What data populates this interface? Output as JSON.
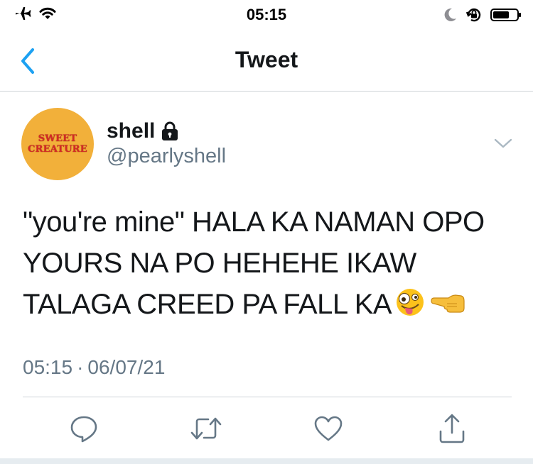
{
  "status_bar": {
    "time": "05:15",
    "battery_level": 0.7,
    "icons": [
      "airplane-icon",
      "wifi-icon",
      "moon-icon",
      "orientation-lock-icon",
      "battery-icon"
    ]
  },
  "nav": {
    "title": "Tweet",
    "back_icon": "chevron-left-icon",
    "accent": "#1da1f2"
  },
  "tweet": {
    "avatar_text": [
      "SWEET",
      "CREATURE"
    ],
    "display_name": "shell",
    "protected_icon": "lock-icon",
    "handle": "@pearlyshell",
    "text": "\"you're mine\" HALA KA NAMAN OPO YOURS NA PO HEHEHE IKAW TALAGA CREED PA FALL KA",
    "emojis": [
      "zany-face-emoji",
      "pointing-left-hand-emoji"
    ],
    "time": "05:15",
    "separator": "·",
    "date": "06/07/21"
  },
  "actions": [
    {
      "name": "reply-button",
      "icon": "reply-icon"
    },
    {
      "name": "retweet-button",
      "icon": "retweet-icon"
    },
    {
      "name": "like-button",
      "icon": "heart-icon"
    },
    {
      "name": "share-button",
      "icon": "share-icon"
    }
  ],
  "colors": {
    "text": "#14171a",
    "secondary": "#657786",
    "divider": "#cfd4d8",
    "avatar_bg": "#f2b03a",
    "avatar_text": "#d42a24"
  }
}
